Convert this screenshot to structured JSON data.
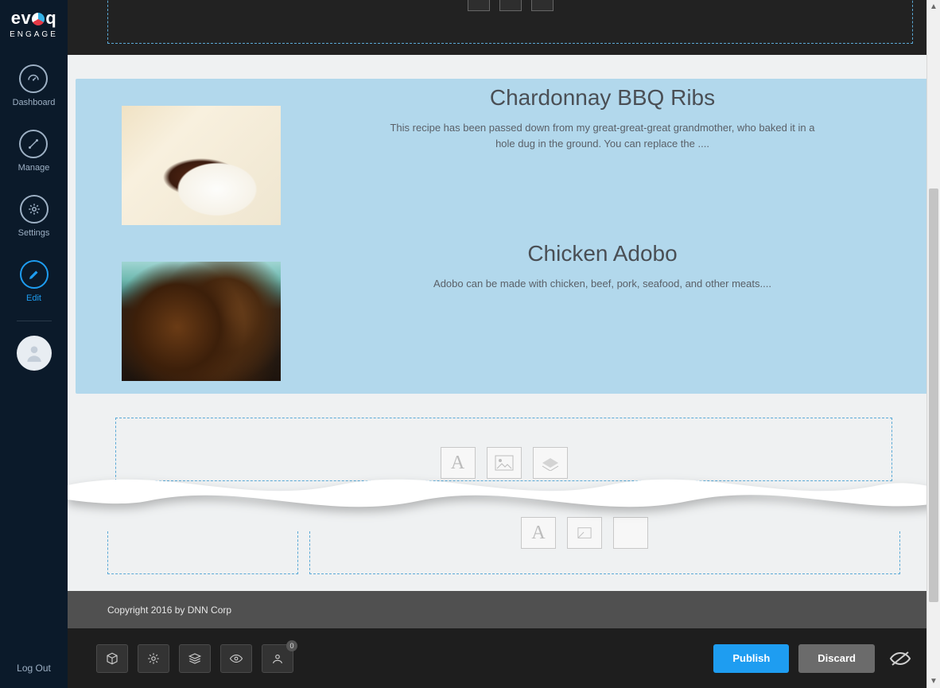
{
  "brand": {
    "name_prefix": "ev",
    "name_suffix": "q",
    "sub": "ENGAGE"
  },
  "sidebar": {
    "items": [
      {
        "label": "Dashboard"
      },
      {
        "label": "Manage"
      },
      {
        "label": "Settings"
      },
      {
        "label": "Edit"
      }
    ],
    "logout": "Log Out"
  },
  "recipes": [
    {
      "title": "Chardonnay BBQ Ribs",
      "desc": "This recipe has been passed down from my great-great-great grandmother, who baked it in a hole dug in the ground. You can replace the ...."
    },
    {
      "title": "Chicken Adobo",
      "desc": "Adobo can be made with chicken, beef, pork, seafood, and other meats...."
    }
  ],
  "footer": {
    "copyright": "Copyright 2016 by DNN Corp"
  },
  "actions": {
    "publish": "Publish",
    "discard": "Discard",
    "badge": "0"
  }
}
